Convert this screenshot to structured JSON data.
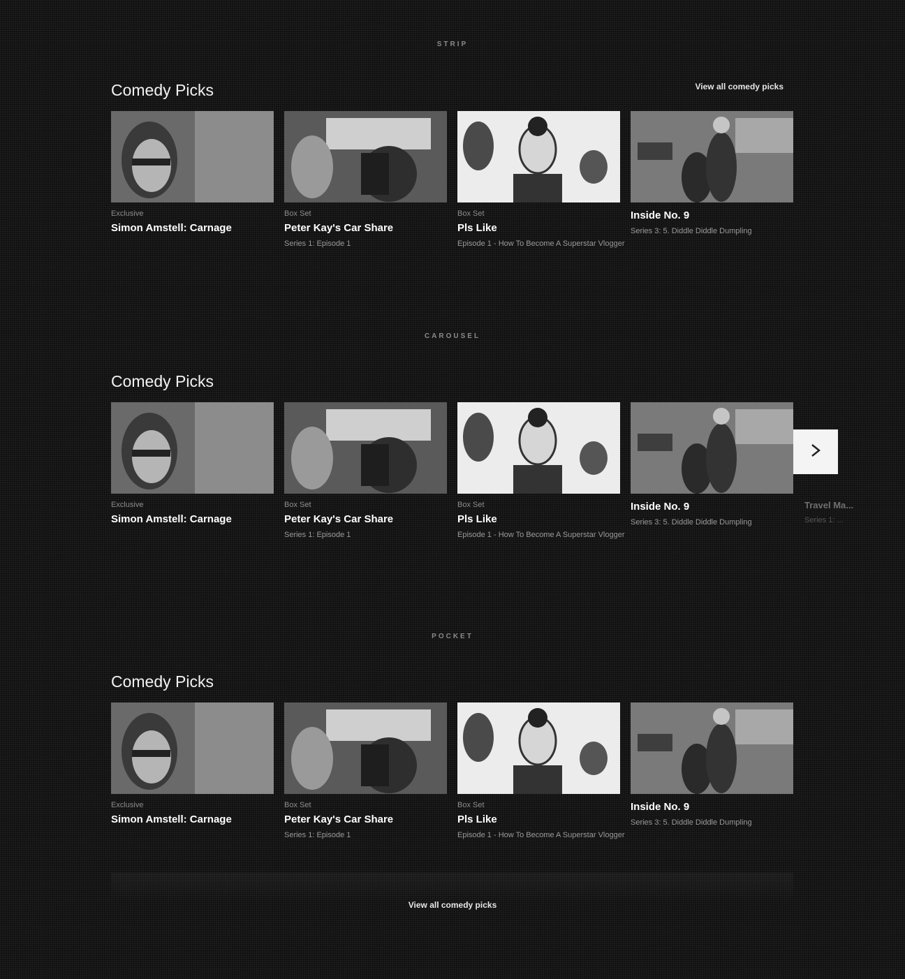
{
  "sections": [
    {
      "label": "STRIP",
      "title": "Comedy Picks",
      "view_all": "View all comedy picks"
    },
    {
      "label": "CAROUSEL",
      "title": "Comedy Picks",
      "peek": {
        "name": "Travel Ma...",
        "sub": "Series 1: ..."
      }
    },
    {
      "label": "POCKET",
      "title": "Comedy Picks",
      "view_all": "View all comedy picks"
    }
  ],
  "tiles": [
    {
      "tag": "Exclusive",
      "name": "Simon Amstell: Carnage",
      "sub": ""
    },
    {
      "tag": "Box Set",
      "name": "Peter Kay's Car Share",
      "sub": "Series 1: Episode 1"
    },
    {
      "tag": "Box Set",
      "name": "Pls Like",
      "sub": "Episode 1 - How To Become A Superstar Vlogger"
    },
    {
      "tag": "",
      "name": "Inside No. 9",
      "sub": "Series 3: 5. Diddle Diddle Dumpling"
    }
  ],
  "icons": {
    "next": "chevron-right-icon"
  }
}
